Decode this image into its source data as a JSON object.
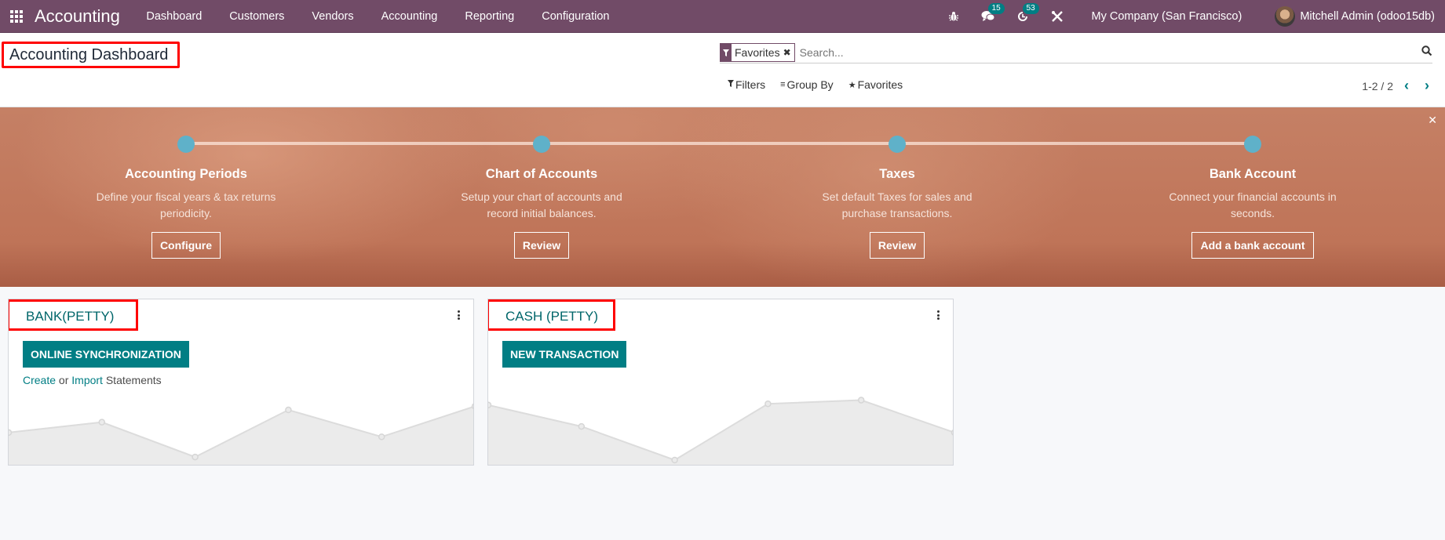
{
  "navbar": {
    "app_name": "Accounting",
    "menu": [
      "Dashboard",
      "Customers",
      "Vendors",
      "Accounting",
      "Reporting",
      "Configuration"
    ],
    "messages_count": "15",
    "activities_count": "53",
    "company": "My Company (San Francisco)",
    "user": "Mitchell Admin (odoo15db)"
  },
  "control_panel": {
    "title": "Accounting Dashboard",
    "search": {
      "facet_label": "Favorites",
      "placeholder": "Search..."
    },
    "filters_label": "Filters",
    "group_by_label": "Group By",
    "favorites_label": "Favorites",
    "pager": "1-2 / 2"
  },
  "onboarding": {
    "steps": [
      {
        "title": "Accounting Periods",
        "desc": "Define your fiscal years & tax returns periodicity.",
        "button": "Configure"
      },
      {
        "title": "Chart of Accounts",
        "desc": "Setup your chart of accounts and record initial balances.",
        "button": "Review"
      },
      {
        "title": "Taxes",
        "desc": "Set default Taxes for sales and purchase transactions.",
        "button": "Review"
      },
      {
        "title": "Bank Account",
        "desc": "Connect your financial accounts in seconds.",
        "button": "Add a bank account"
      }
    ]
  },
  "journals": [
    {
      "name": "BANK(PETTY)",
      "button": "ONLINE SYNCHRONIZATION",
      "links": {
        "create": "Create",
        "or": "or",
        "import": "Import",
        "suffix": "Statements"
      },
      "sparkline": [
        0.45,
        0.62,
        0.05,
        0.82,
        0.38,
        0.88
      ]
    },
    {
      "name": "CASH (PETTY)",
      "button": "NEW TRANSACTION",
      "sparkline": [
        0.9,
        0.55,
        0.0,
        0.92,
        0.98,
        0.45
      ]
    }
  ],
  "colors": {
    "brand": "#714b67",
    "accent": "#017e84",
    "banner": "#c07558",
    "step_dot": "#5fb1c9",
    "highlight": "#ff0000"
  }
}
